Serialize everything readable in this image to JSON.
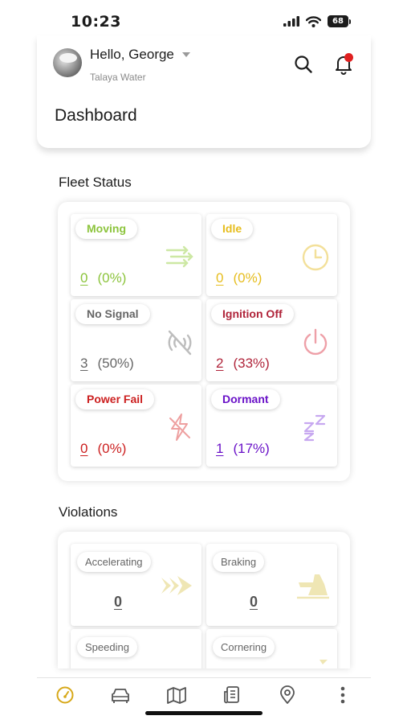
{
  "status_bar": {
    "time": "10:23",
    "battery": "68"
  },
  "header": {
    "greeting": "Hello, George",
    "company": "Talaya Water",
    "page_title": "Dashboard"
  },
  "fleet_status": {
    "title": "Fleet Status",
    "cards": [
      {
        "label": "Moving",
        "count": "0",
        "percent": "(0%)",
        "color": "#8cc43c",
        "icon": "moving-arrows-icon"
      },
      {
        "label": "Idle",
        "count": "0",
        "percent": "(0%)",
        "color": "#e6bd1e",
        "icon": "clock-icon"
      },
      {
        "label": "No Signal",
        "count": "3",
        "percent": "(50%)",
        "color": "#666666",
        "icon": "no-signal-icon"
      },
      {
        "label": "Ignition Off",
        "count": "2",
        "percent": "(33%)",
        "color": "#b0243a",
        "icon": "power-icon"
      },
      {
        "label": "Power Fail",
        "count": "0",
        "percent": "(0%)",
        "color": "#cc2020",
        "icon": "power-fail-bolt-icon"
      },
      {
        "label": "Dormant",
        "count": "1",
        "percent": "(17%)",
        "color": "#6a12c8",
        "icon": "sleep-zzz-icon"
      }
    ]
  },
  "violations": {
    "title": "Violations",
    "cards": [
      {
        "label": "Accelerating",
        "count": "0",
        "icon": "accelerating-icon"
      },
      {
        "label": "Braking",
        "count": "0",
        "icon": "braking-icon"
      },
      {
        "label": "Speeding",
        "count": "",
        "icon": "speeding-icon"
      },
      {
        "label": "Cornering",
        "count": "",
        "icon": "cornering-icon"
      }
    ]
  },
  "bottom_nav": {
    "items": [
      "dashboard-gauge-icon",
      "vehicle-icon",
      "map-icon",
      "reports-icon",
      "location-pin-icon",
      "more-dots-icon"
    ],
    "active_color": "#d7a818"
  }
}
